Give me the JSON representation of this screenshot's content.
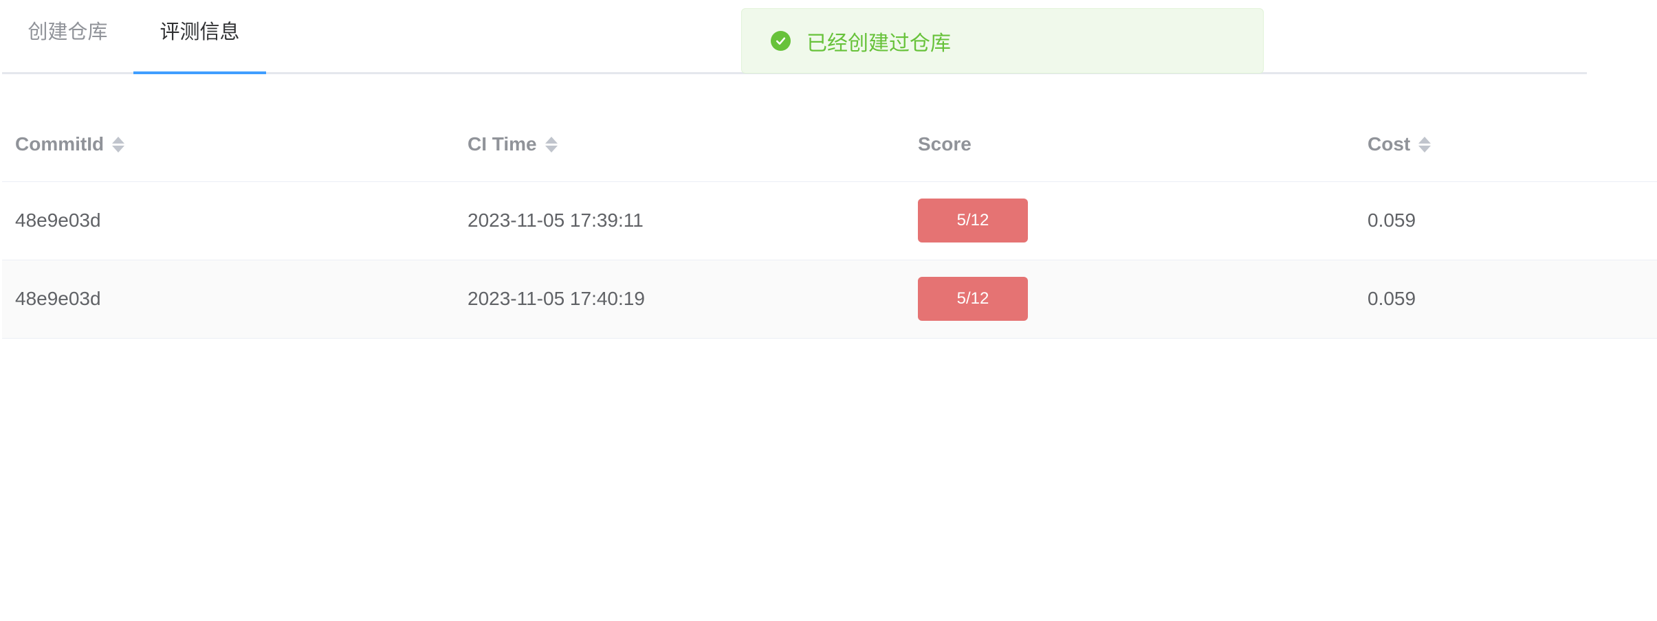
{
  "tabs": [
    {
      "label": "创建仓库",
      "active": false
    },
    {
      "label": "评测信息",
      "active": true
    }
  ],
  "toast": {
    "message": "已经创建过仓库",
    "icon": "check-circle-icon",
    "color": "#67c23a"
  },
  "table": {
    "columns": [
      {
        "label": "CommitId",
        "sortable": true
      },
      {
        "label": "CI Time",
        "sortable": true
      },
      {
        "label": "Score",
        "sortable": false
      },
      {
        "label": "Cost",
        "sortable": true
      }
    ],
    "rows": [
      {
        "commit_id": "48e9e03d",
        "ci_time": "2023-11-05 17:39:11",
        "score": "5/12",
        "cost": "0.059"
      },
      {
        "commit_id": "48e9e03d",
        "ci_time": "2023-11-05 17:40:19",
        "score": "5/12",
        "cost": "0.059"
      }
    ]
  },
  "colors": {
    "accent": "#409eff",
    "score_tag": "#e57373"
  }
}
